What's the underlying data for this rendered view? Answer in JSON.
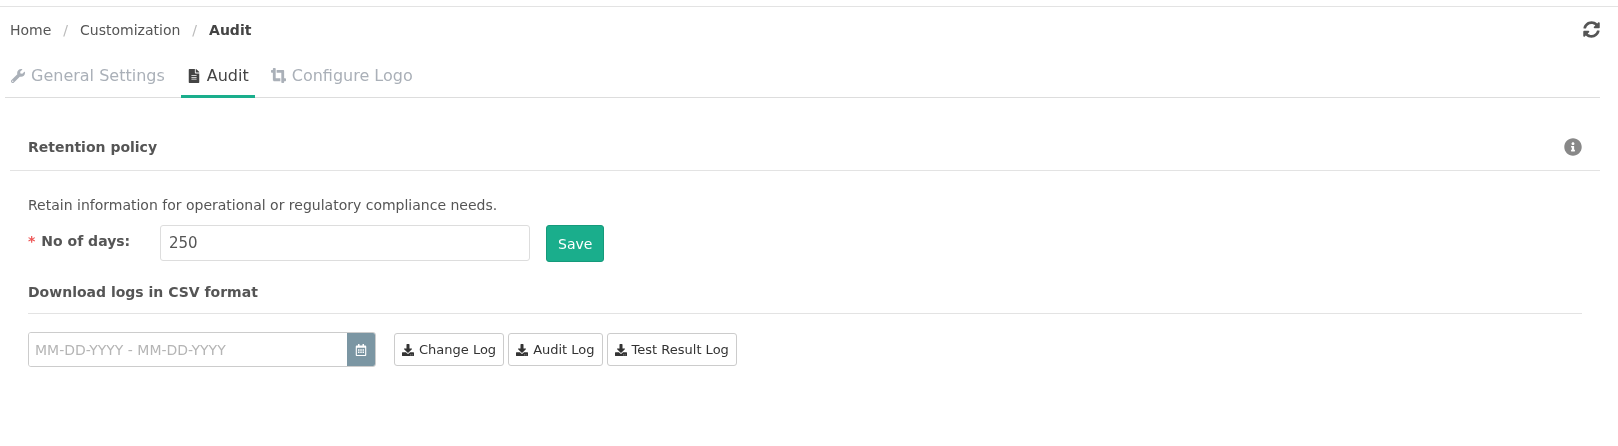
{
  "breadcrumb": [
    {
      "label": "Home",
      "current": false
    },
    {
      "label": "Customization",
      "current": false
    },
    {
      "label": "Audit",
      "current": true
    }
  ],
  "separator": "/",
  "tabs": [
    {
      "label": "General Settings",
      "kind": "wrench",
      "selected": false
    },
    {
      "label": "Audit",
      "kind": "file",
      "selected": true
    },
    {
      "label": "Configure Logo",
      "kind": "crop",
      "selected": false
    }
  ],
  "retention": {
    "title": "Retention policy",
    "description": "Retain information for operational or regulatory compliance needs.",
    "required_mark": "*",
    "days_label": "No of days:",
    "days_value": "250",
    "save_button": "Save"
  },
  "download": {
    "title": "Download logs in CSV format",
    "date_placeholder": "MM-DD-YYYY - MM-DD-YYYY",
    "buttons": [
      "Change Log",
      "Audit Log",
      "Test Result Log"
    ]
  }
}
